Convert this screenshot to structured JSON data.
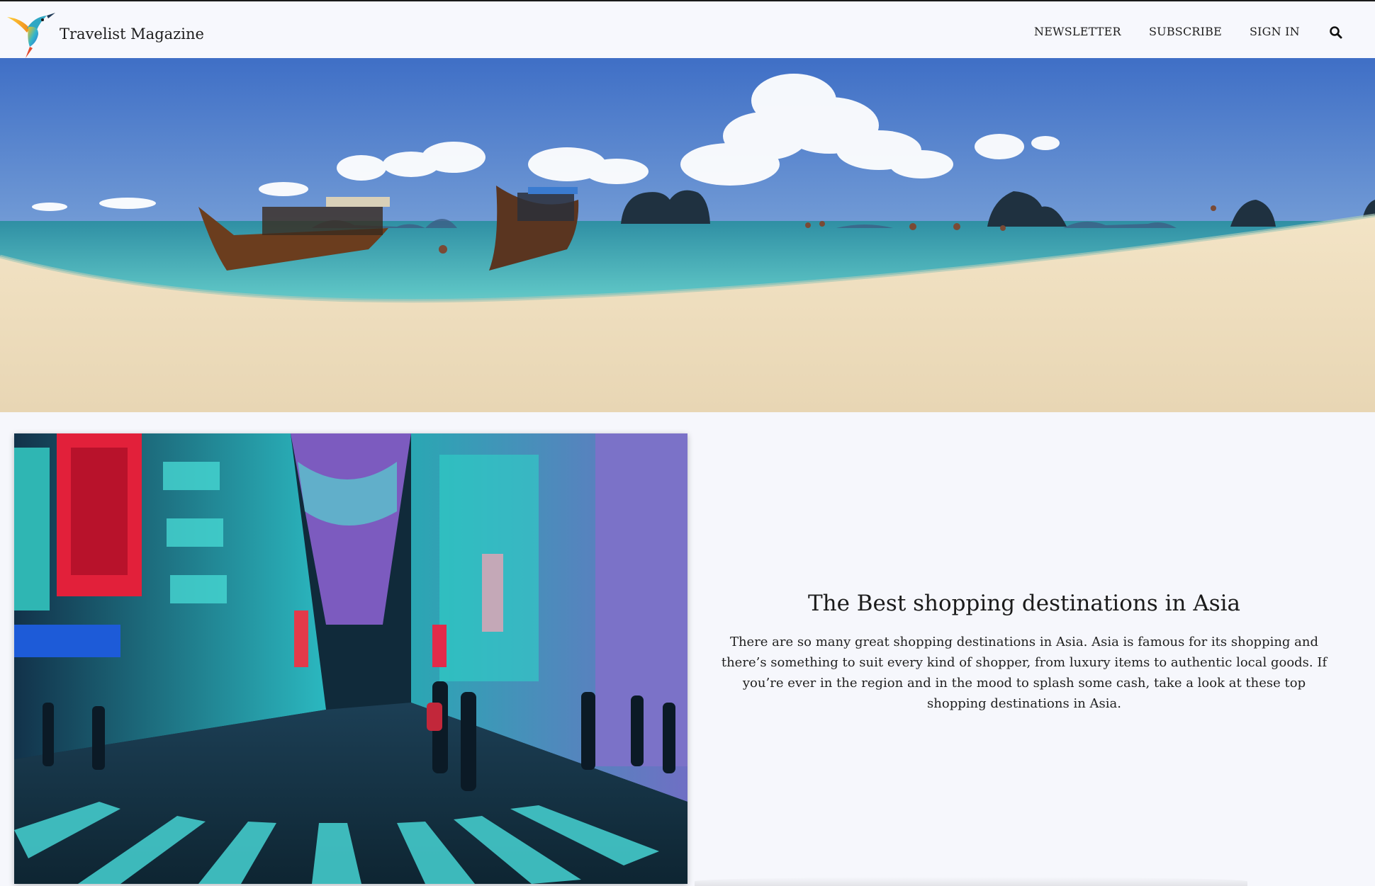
{
  "header": {
    "brand": "Travelist Magazine",
    "logo_icon": "hummingbird-logo-icon",
    "nav": [
      {
        "label": "NEWSLETTER"
      },
      {
        "label": "SUBSCRIBE"
      },
      {
        "label": "SIGN IN"
      }
    ],
    "search_icon": "search-icon"
  },
  "hero": {
    "image": "tropical-beach-longtail-boats-photo"
  },
  "feature": {
    "image": "neon-city-shopping-street-photo",
    "title": "The Best shopping destinations in Asia",
    "body": "There are so many great shopping destinations in Asia. Asia is famous for its shopping and there’s something to suit every kind of shopper, from luxury items to authentic local goods. If you’re ever in the region and in the mood to splash some cash, take a look at these top shopping destinations in Asia."
  },
  "colors": {
    "page_background": "#f6f7fc",
    "text": "#1b1b1b"
  }
}
